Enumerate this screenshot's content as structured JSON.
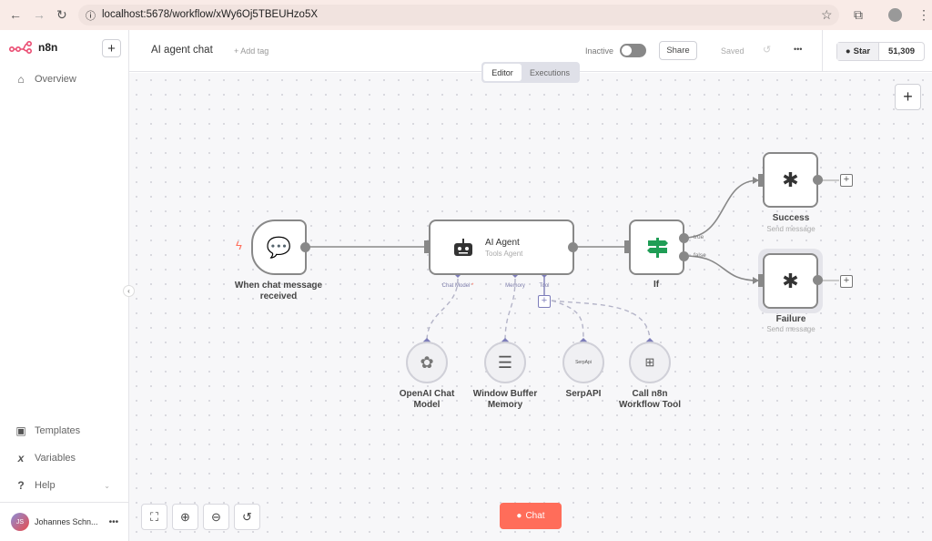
{
  "browser": {
    "url": "localhost:5678/workflow/xWy6Oj5TBEUHzo5X"
  },
  "sidebar": {
    "brand": "n8n",
    "items": [
      {
        "label": "Overview",
        "icon": "home-icon"
      },
      {
        "label": "Templates",
        "icon": "box-icon"
      },
      {
        "label": "Variables",
        "icon": "variable-icon"
      },
      {
        "label": "Help",
        "icon": "question-icon"
      }
    ],
    "user": {
      "name": "Johannes Schn...",
      "initials": "JS"
    }
  },
  "header": {
    "title": "AI agent chat",
    "add_tag": "+ Add tag",
    "status": "Inactive",
    "active": false,
    "share": "Share",
    "saved": "Saved",
    "star": "Star",
    "star_count": "51,309"
  },
  "tabs": [
    {
      "label": "Editor",
      "active": true
    },
    {
      "label": "Executions",
      "active": false
    }
  ],
  "nodes": {
    "trigger": {
      "label1": "When chat message",
      "label2": "received"
    },
    "agent": {
      "title": "AI Agent",
      "subtitle": "Tools Agent",
      "handles": [
        "Chat Model",
        "Memory",
        "Tool"
      ],
      "required_mark": "*"
    },
    "if": {
      "label": "If",
      "outputs": [
        "true",
        "false"
      ]
    },
    "success": {
      "label": "Success",
      "subtitle": "Send message"
    },
    "failure": {
      "label": "Failure",
      "subtitle": "Send message"
    },
    "subnodes": [
      {
        "l1": "OpenAI Chat",
        "l2": "Model"
      },
      {
        "l1": "Window Buffer",
        "l2": "Memory"
      },
      {
        "l1": "SerpAPI",
        "l2": "",
        "logo": "SerpApi"
      },
      {
        "l1": "Call n8n",
        "l2": "Workflow Tool"
      }
    ]
  },
  "chat_button": "Chat",
  "colors": {
    "accent": "#ff6d5a",
    "handle": "#7d7dba",
    "if_green": "#1f9d55"
  }
}
